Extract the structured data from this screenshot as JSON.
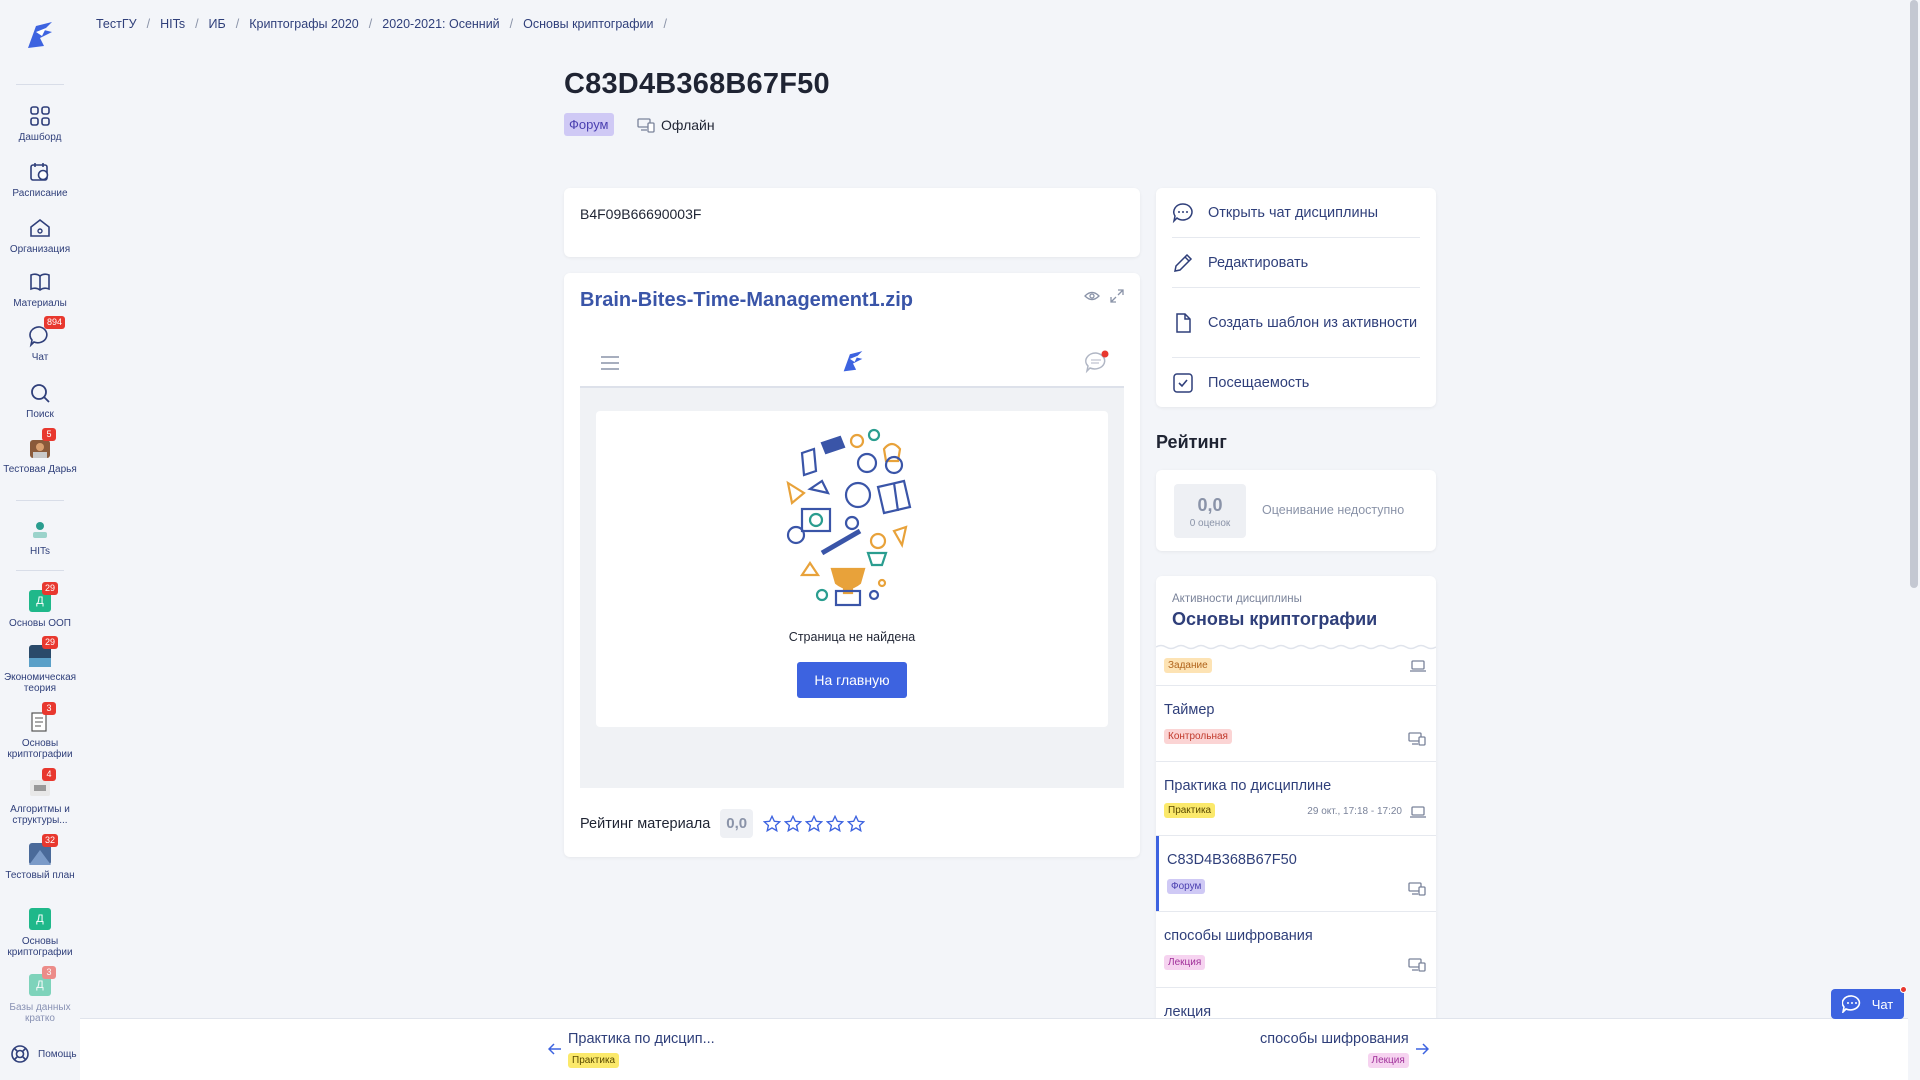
{
  "sidebar": {
    "items": [
      {
        "label": "Дашборд"
      },
      {
        "label": "Расписание"
      },
      {
        "label": "Организация"
      },
      {
        "label": "Материалы"
      },
      {
        "label": "Чат",
        "badge": "894"
      },
      {
        "label": "Поиск"
      },
      {
        "label": "Тестовая Дарья",
        "badge": "5"
      },
      {
        "label": "HITs"
      },
      {
        "label": "Основы ООП",
        "badge": "29",
        "avatar": "Д"
      },
      {
        "label": "Экономическая теория",
        "badge": "29"
      },
      {
        "label": "Основы криптографии",
        "badge": "3"
      },
      {
        "label": "Алгоритмы и структуры...",
        "badge": "4"
      },
      {
        "label": "Тестовый план",
        "badge": "32"
      },
      {
        "label": "Основы криптографии",
        "avatar": "Д"
      },
      {
        "label": "Базы данных кратко",
        "badge": "3",
        "avatar": "Д"
      }
    ],
    "help": "Помощь"
  },
  "breadcrumb": [
    "ТестГУ",
    "HITs",
    "ИБ",
    "Криптографы 2020",
    "2020-2021: Осенний",
    "Основы криптографии"
  ],
  "page": {
    "title": "C83D4B368B67F50",
    "type_badge": "Форум",
    "status": "Офлайн"
  },
  "description": "B4F09B66690003F",
  "material": {
    "title": "Brain-Bites-Time-Management1.zip",
    "not_found": "Страница не найдена",
    "home_button": "На главную",
    "rating_label": "Рейтинг материала",
    "rating_value": "0,0"
  },
  "actions": [
    {
      "label": "Открыть чат дисциплины",
      "icon": "chat-icon"
    },
    {
      "label": "Редактировать",
      "icon": "pencil-icon"
    },
    {
      "label": "Создать шаблон из активности",
      "icon": "file-icon"
    },
    {
      "label": "Посещаемость",
      "icon": "checkbox-icon"
    }
  ],
  "rating": {
    "heading": "Рейтинг",
    "value": "0,0",
    "count": "0 оценок",
    "note": "Оценивание недоступно"
  },
  "activities": {
    "subtitle": "Активности дисциплины",
    "title": "Основы криптографии",
    "items": [
      {
        "name": "",
        "tag": "Задание"
      },
      {
        "name": "Таймер",
        "tag": "Контрольная"
      },
      {
        "name": "Практика по дисциплине",
        "tag": "Практика",
        "date": "29 окт., 17:18 - 17:20"
      },
      {
        "name": "C83D4B368B67F50",
        "tag": "Форум",
        "active": true
      },
      {
        "name": "способы шифрования",
        "tag": "Лекция"
      },
      {
        "name": "лекция",
        "tag": ""
      }
    ]
  },
  "bottom_nav": {
    "prev_title": "Практика по дисцип...",
    "prev_tag": "Практика",
    "next_title": "способы шифрования",
    "next_tag": "Лекция"
  },
  "chat_button": "Чат",
  "colors": {
    "accent": "#3d63e0",
    "badge_red": "#e8382f",
    "link": "#2f3f7a"
  }
}
